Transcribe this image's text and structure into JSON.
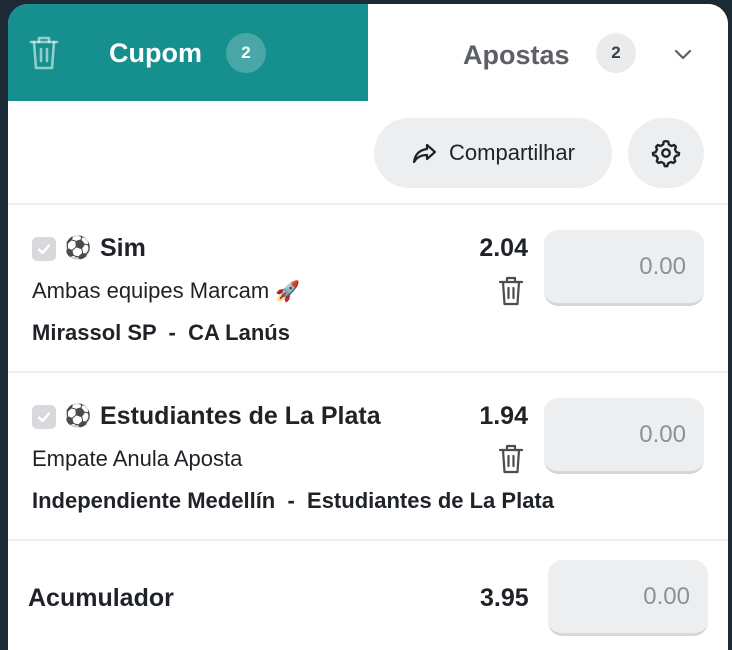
{
  "tabs": {
    "cupom": {
      "label": "Cupom",
      "count": "2"
    },
    "apostas": {
      "label": "Apostas",
      "count": "2"
    }
  },
  "toolbar": {
    "share_label": "Compartilhar"
  },
  "bets": [
    {
      "selection": "Sim",
      "market": "Ambas equipes Marcam",
      "market_emoji": "🚀",
      "match": "Mirassol SP  -  CA Lanús",
      "odds": "2.04",
      "stake_placeholder": "0.00",
      "checked": true,
      "sport_icon": "⚽"
    },
    {
      "selection": "Estudiantes de La Plata",
      "market": "Empate Anula Aposta",
      "match": "Independiente Medellín  -  Estudiantes de La Plata",
      "odds": "1.94",
      "stake_placeholder": "0.00",
      "checked": true,
      "sport_icon": "⚽"
    }
  ],
  "accumulator": {
    "label": "Acumulador",
    "odds": "3.95",
    "stake_placeholder": "0.00"
  },
  "colors": {
    "accent": "#16908f",
    "background": "#1c2a35",
    "input_bg": "#eceef0"
  }
}
